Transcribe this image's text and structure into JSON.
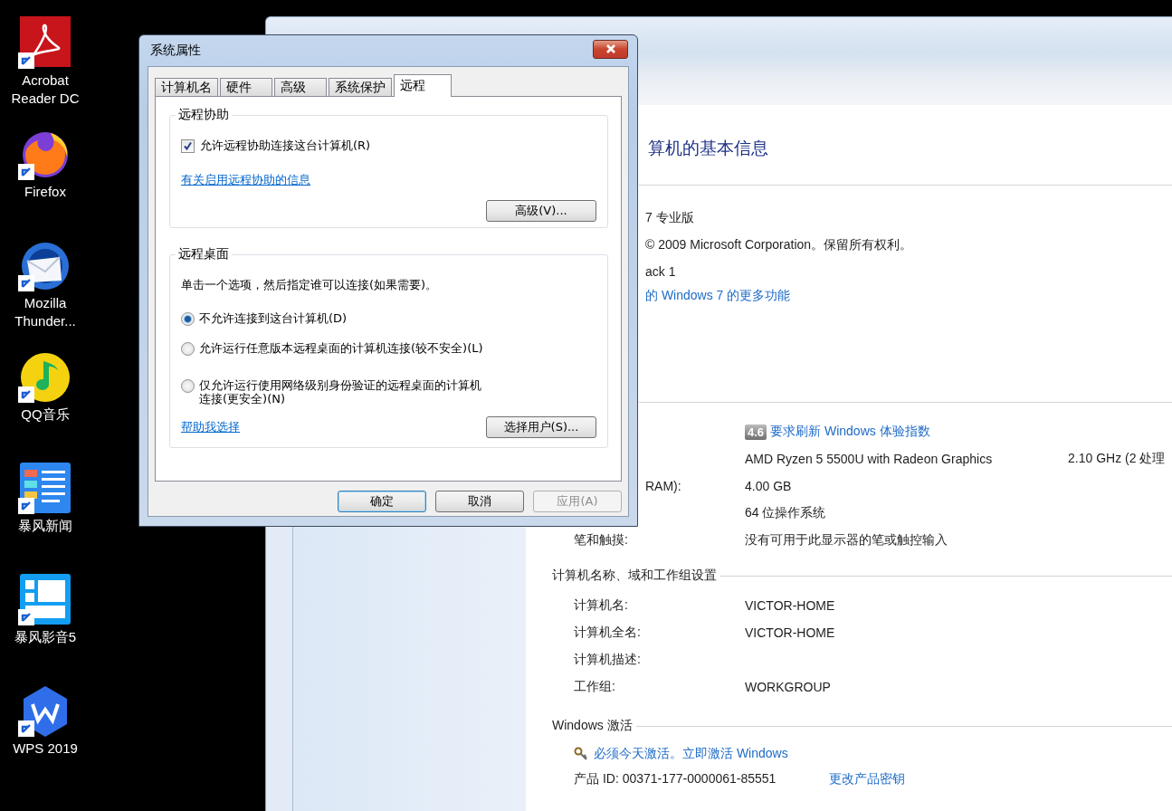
{
  "desktop_icons": [
    {
      "label": "Acrobat Reader DC",
      "kind": "pdf"
    },
    {
      "label": "Firefox",
      "kind": "browser"
    },
    {
      "label": "Mozilla Thunder...",
      "kind": "mail"
    },
    {
      "label": "QQ音乐",
      "kind": "music"
    },
    {
      "label": "暴风新闻",
      "kind": "news"
    },
    {
      "label": "暴风影音5",
      "kind": "player"
    },
    {
      "label": "WPS 2019",
      "kind": "office"
    }
  ],
  "system_window": {
    "heading": "算机的基本信息",
    "edition_lines": [
      {
        "text": "7 专业版",
        "kind": "text"
      },
      {
        "text": "© 2009 Microsoft Corporation。保留所有权利。",
        "kind": "text"
      },
      {
        "text": "ack 1",
        "kind": "text"
      },
      {
        "text": "的 Windows 7 的更多功能",
        "kind": "link"
      }
    ],
    "system_rows": [
      {
        "kind": "rating",
        "rating": "4.6",
        "value": "要求刷新 Windows 体验指数"
      },
      {
        "kind": "cpu",
        "value": "AMD Ryzen 5 5500U with Radeon Graphics",
        "extra": "2.10 GHz  (2 处理"
      },
      {
        "kind": "cut",
        "label": "RAM):",
        "value": "4.00 GB"
      },
      {
        "kind": "plain",
        "value": "64 位操作系统"
      },
      {
        "kind": "plain",
        "label": "笔和触摸:",
        "value": "没有可用于此显示器的笔或触控输入"
      }
    ],
    "name_section": {
      "title": "计算机名称、域和工作组设置",
      "rows": [
        {
          "label": "计算机名:",
          "value": "VICTOR-HOME"
        },
        {
          "label": "计算机全名:",
          "value": "VICTOR-HOME"
        },
        {
          "label": "计算机描述:"
        },
        {
          "label": "工作组:",
          "value": "WORKGROUP"
        }
      ]
    },
    "activation": {
      "title": "Windows 激活",
      "link": "必须今天激活。立即激活 Windows",
      "product_id": "产品 ID: 00371-177-0000061-85551",
      "change_key": "更改产品密钥"
    }
  },
  "dialog": {
    "title": "系统属性",
    "tabs": [
      {
        "label": "计算机名",
        "selected": false
      },
      {
        "label": "硬件",
        "selected": false
      },
      {
        "label": "高级",
        "selected": false
      },
      {
        "label": "系统保护",
        "selected": false
      },
      {
        "label": "远程",
        "selected": true
      }
    ],
    "remote_assistance": {
      "title": "远程协助",
      "checkbox": {
        "label": "允许远程协助连接这台计算机(R)",
        "checked": true
      },
      "link": "有关启用远程协助的信息",
      "button": "高级(V)..."
    },
    "remote_desktop": {
      "title": "远程桌面",
      "instruction": "单击一个选项，然后指定谁可以连接(如果需要)。",
      "options": [
        {
          "label": "不允许连接到这台计算机(D)",
          "selected": true
        },
        {
          "label": "允许运行任意版本远程桌面的计算机连接(较不安全)(L)",
          "selected": false
        },
        {
          "label": "仅允许运行使用网络级别身份验证的远程桌面的计算机连接(更安全)(N)",
          "selected": false
        }
      ],
      "link": "帮助我选择",
      "button": "选择用户(S)..."
    },
    "buttons": [
      {
        "label": "确定",
        "default": true,
        "disabled": false
      },
      {
        "label": "取消",
        "default": false,
        "disabled": false
      },
      {
        "label": "应用(A)",
        "default": false,
        "disabled": true
      }
    ]
  }
}
